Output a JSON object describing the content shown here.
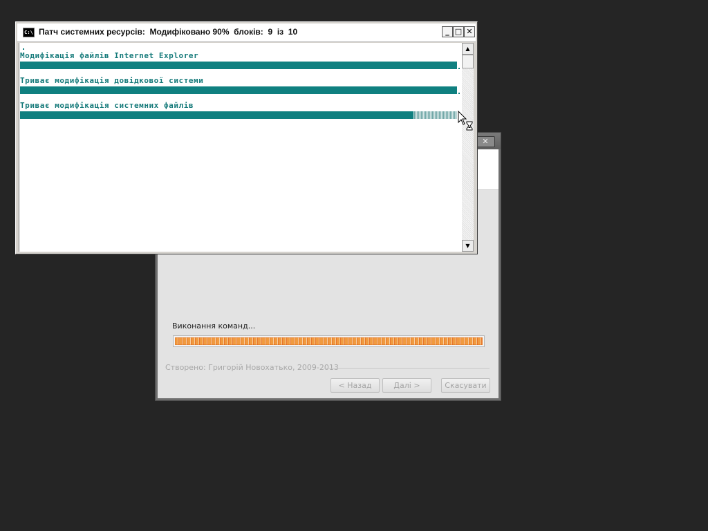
{
  "console": {
    "title": "Патч системних ресурсів:  Модифіковано 90%  блоків:  9  із  10",
    "icon_text": "C:\\",
    "minimize_glyph": "_",
    "maximize_glyph": "□",
    "close_glyph": "✕",
    "lines": [
      {
        "text": "Модифікація файлів Internet Explorer",
        "progress": 1.0
      },
      {
        "text": "Триває модифікація довідкової системи",
        "progress": 1.0
      },
      {
        "text": "Триває модифікація системних файлів",
        "progress": 0.9
      }
    ],
    "colors": {
      "text": "#157a7a",
      "bar": "#0f8080",
      "title_bg": "#ffffff"
    },
    "scroll_up_glyph": "▲",
    "scroll_down_glyph": "▼"
  },
  "installer": {
    "close_glyph": "✕",
    "status_label": "Виконання команд...",
    "progress": 1.0,
    "branding": "Створено: Григорій Новохатько, 2009-2013",
    "buttons": {
      "back": "< Назад",
      "next": "Далі >",
      "cancel": "Скасувати"
    },
    "colors": {
      "progress_fill": "#f09a40",
      "dialog_bg": "#e3e3e3"
    }
  },
  "desktop": {
    "background": "#252525"
  },
  "mouse_cursor": {
    "icon": "busy-arrow-hourglass-icon"
  }
}
